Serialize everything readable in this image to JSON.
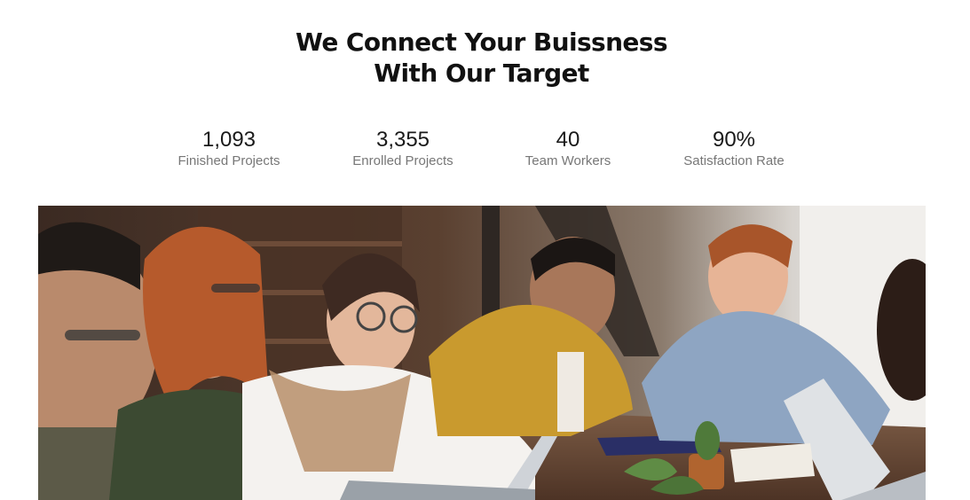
{
  "heading": {
    "line1": "We Connect Your Buissness",
    "line2": "With Our Target"
  },
  "stats": [
    {
      "value": "1,093",
      "label": "Finished Projects"
    },
    {
      "value": "3,355",
      "label": "Enrolled Projects"
    },
    {
      "value": "40",
      "label": "Team Workers"
    },
    {
      "value": "90%",
      "label": "Satisfaction Rate"
    }
  ],
  "photo": {
    "alt_icon": "team-photo"
  }
}
